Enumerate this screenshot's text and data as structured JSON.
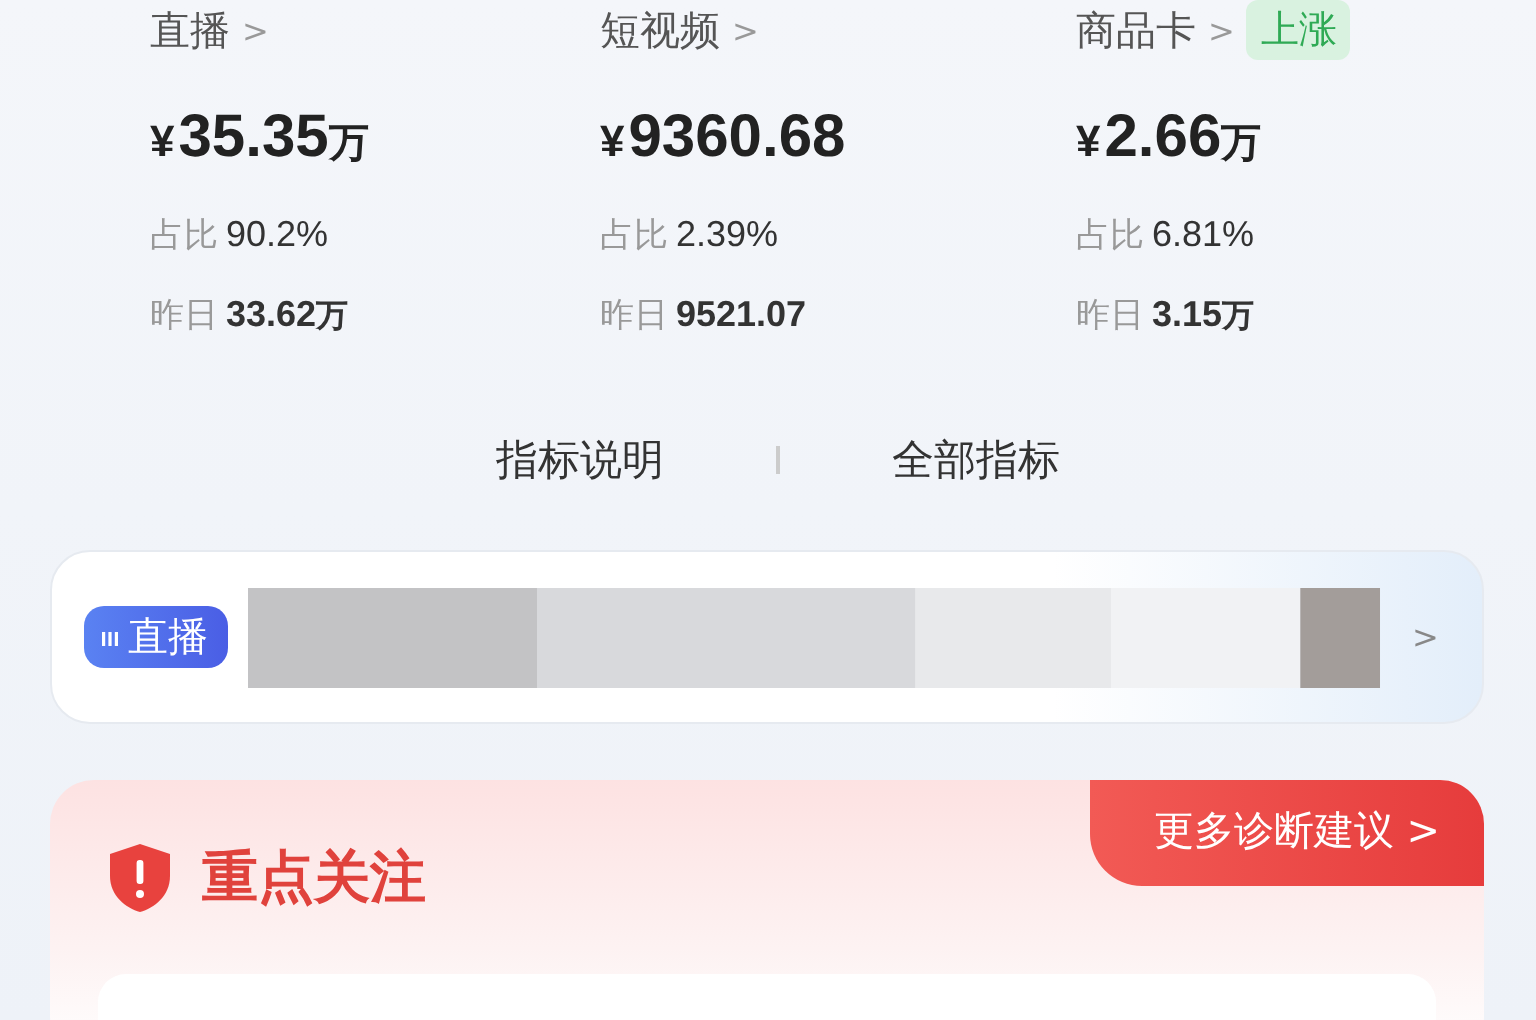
{
  "metrics": [
    {
      "title": "直播",
      "arrow": ">",
      "currency": "¥",
      "amount": "35.35",
      "unit": "万",
      "ratio_label": "占比",
      "ratio": "90.2%",
      "yesterday_label": "昨日",
      "yesterday": "33.62",
      "yesterday_unit": "万"
    },
    {
      "title": "短视频",
      "arrow": ">",
      "currency": "¥",
      "amount": "9360.68",
      "ratio_label": "占比",
      "ratio": "2.39%",
      "yesterday_label": "昨日",
      "yesterday": "9521.07"
    },
    {
      "title": "商品卡",
      "arrow": ">",
      "badge": "上涨",
      "currency": "¥",
      "amount": "2.66",
      "unit": "万",
      "ratio_label": "占比",
      "ratio": "6.81%",
      "yesterday_label": "昨日",
      "yesterday": "3.15",
      "yesterday_unit": "万"
    }
  ],
  "links": [
    "指标说明",
    "全部指标"
  ],
  "live_bar": {
    "tag": "直播",
    "arrow": ">"
  },
  "attention": {
    "title": "重点关注",
    "more": "更多诊断建议 >"
  }
}
